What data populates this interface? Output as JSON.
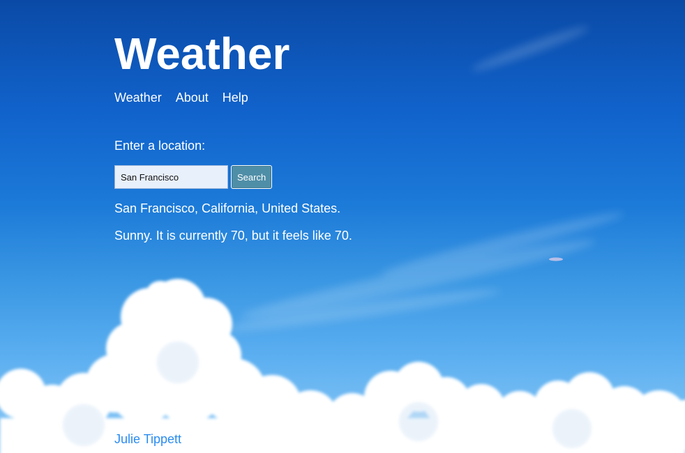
{
  "header": {
    "title": "Weather"
  },
  "nav": {
    "items": [
      {
        "label": "Weather"
      },
      {
        "label": "About"
      },
      {
        "label": "Help"
      }
    ]
  },
  "search": {
    "label": "Enter a location:",
    "value": "San Francisco",
    "button_label": "Search"
  },
  "results": {
    "location": "San Francisco, California, United States.",
    "forecast": "Sunny. It is currently 70, but it feels like 70."
  },
  "footer": {
    "author": "Julie Tippett"
  },
  "colors": {
    "sky_top": "#0a4aa6",
    "sky_bottom": "#8fcaf7",
    "button_bg": "#4f8ea7",
    "footer_link": "#2a8cf0"
  }
}
